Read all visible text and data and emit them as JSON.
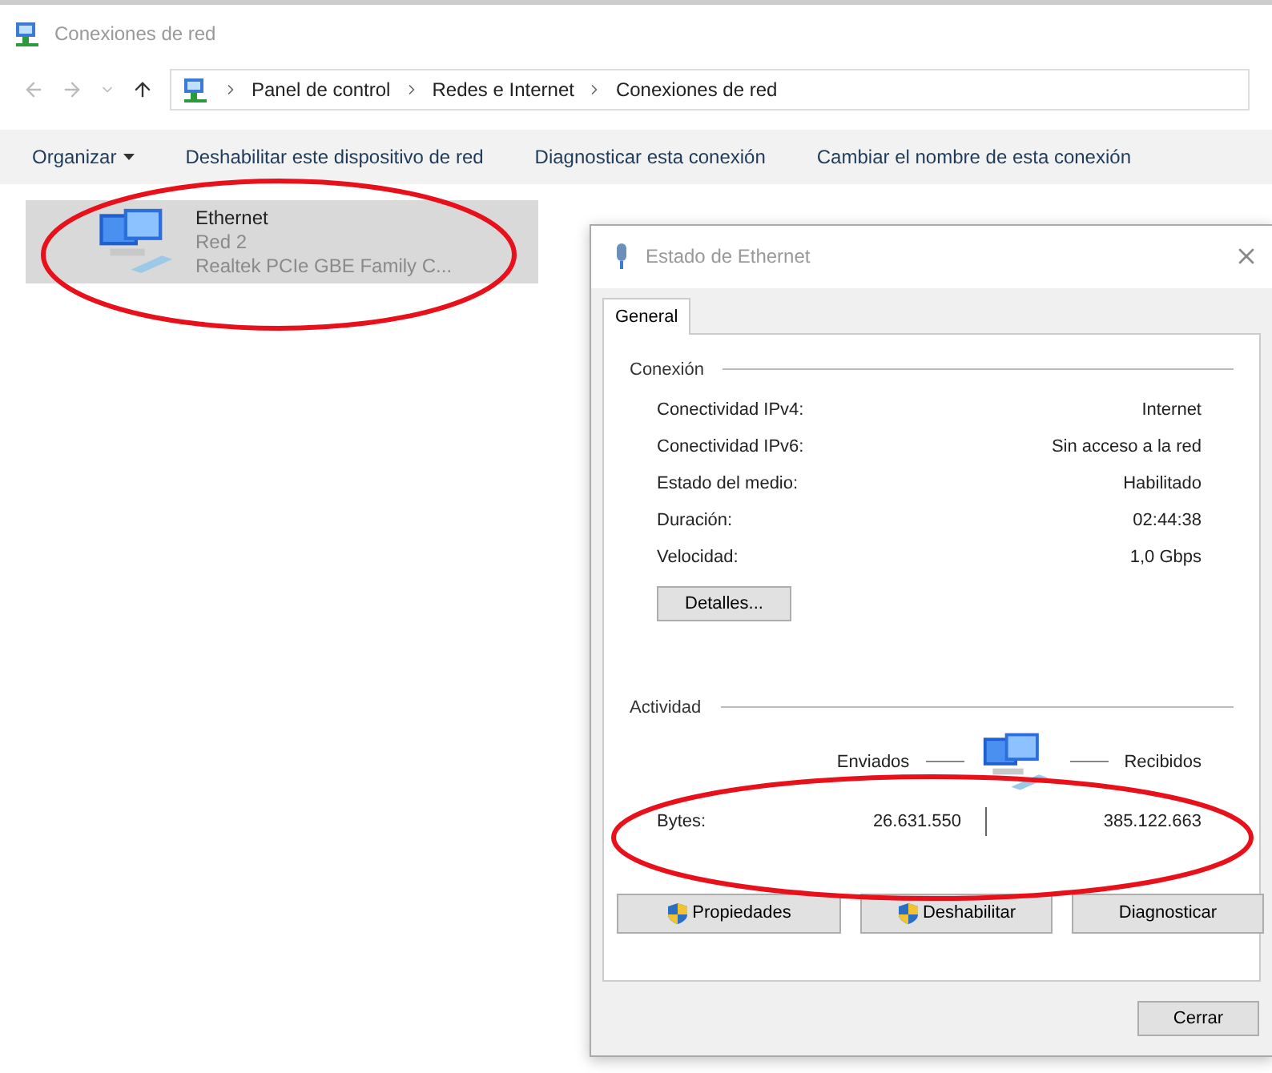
{
  "window": {
    "title": "Conexiones de red"
  },
  "address": {
    "path": [
      "Panel de control",
      "Redes e Internet",
      "Conexiones de red"
    ]
  },
  "toolbar": [
    {
      "label": "Organizar",
      "kind": "menu"
    },
    {
      "label": "Deshabilitar este dispositivo de red",
      "kind": "action"
    },
    {
      "label": "Diagnosticar esta conexión",
      "kind": "action"
    },
    {
      "label": "Cambiar el nombre de esta conexión",
      "kind": "action"
    }
  ],
  "items": [
    {
      "name": "Ethernet",
      "network": "Red 2",
      "adapter": "Realtek PCIe GBE Family C...",
      "selected": true
    }
  ],
  "dialog": {
    "title": "Estado de Ethernet",
    "tabs": [
      {
        "label": "General",
        "selected": true
      }
    ],
    "connection": {
      "heading": "Conexión",
      "rows": [
        {
          "label": "Conectividad IPv4:",
          "value": "Internet"
        },
        {
          "label": "Conectividad IPv6:",
          "value": "Sin acceso a la red"
        },
        {
          "label": "Estado del medio:",
          "value": "Habilitado"
        },
        {
          "label": "Duración:",
          "value": "02:44:38"
        },
        {
          "label": "Velocidad:",
          "value": "1,0 Gbps"
        }
      ],
      "button": "Detalles..."
    },
    "activity": {
      "heading": "Actividad",
      "sent_label": "Enviados",
      "received_label": "Recibidos",
      "bytes_label": "Bytes:",
      "sent": "26.631.550",
      "received": "385.122.663"
    },
    "buttons": [
      {
        "label": "Propiedades",
        "shield": true
      },
      {
        "label": "Deshabilitar",
        "shield": true
      },
      {
        "label": "Diagnosticar",
        "shield": false
      }
    ],
    "close_button": "Cerrar"
  }
}
